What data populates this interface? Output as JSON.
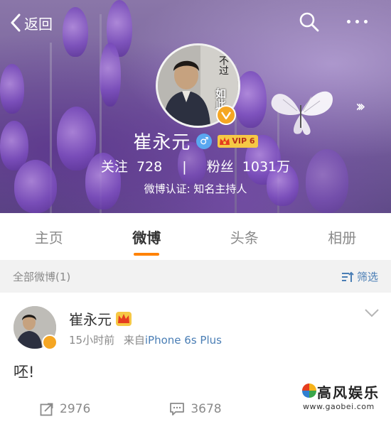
{
  "topbar": {
    "back_label": "返回"
  },
  "profile": {
    "name": "崔永元",
    "vip_label": "VIP 6",
    "follow_label": "关注",
    "follow_count": "728",
    "separator": "|",
    "fans_label": "粉丝",
    "fans_count": "1031万",
    "certification": "微博认证: 知名主持人",
    "avatar_text_top": "不过",
    "avatar_text_bottom": "如此"
  },
  "tabs": [
    {
      "label": "主页",
      "active": false
    },
    {
      "label": "微博",
      "active": true
    },
    {
      "label": "头条",
      "active": false
    },
    {
      "label": "相册",
      "active": false
    }
  ],
  "filter": {
    "all_label": "全部微博(1)",
    "filter_label": "筛选"
  },
  "post": {
    "author": "崔永元",
    "time": "15小时前",
    "from_label": "来自",
    "source": "iPhone 6s Plus",
    "text": "呸!",
    "repost_count": "2976",
    "comment_count": "3678"
  },
  "watermark": {
    "title": "高风娱乐",
    "url": "www.gaobei.com"
  },
  "colors": {
    "accent": "#ff8200",
    "link": "#4a7eb5",
    "verify": "#f5a623",
    "gender": "#5aa7f0"
  },
  "icons": [
    "back-icon",
    "search-icon",
    "more-icon",
    "verify-icon",
    "gender-male-icon",
    "vip-crown-icon",
    "forward-arrows-icon",
    "filter-icon",
    "chevron-down-icon",
    "repost-icon",
    "comment-icon"
  ]
}
